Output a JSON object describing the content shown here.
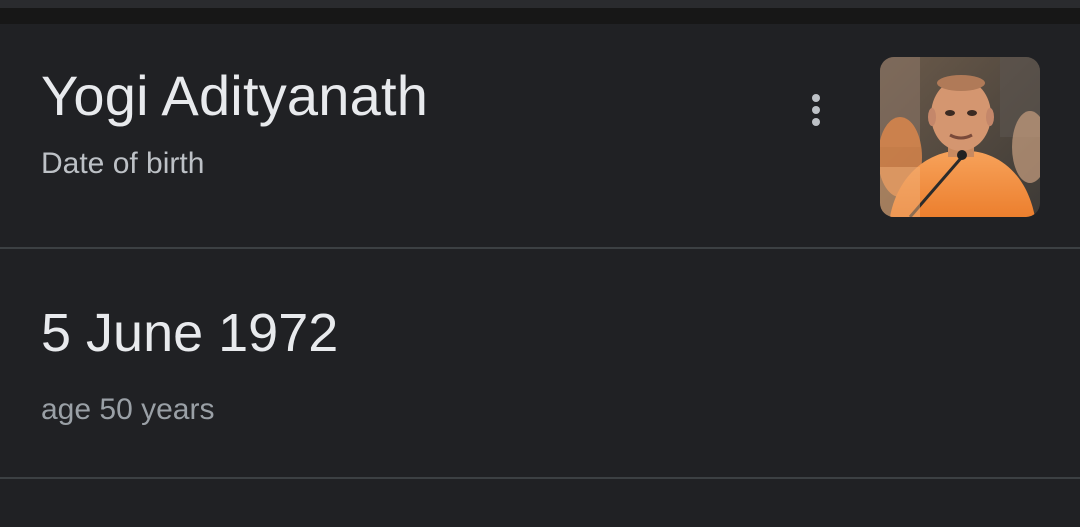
{
  "entity": {
    "name": "Yogi Adityanath",
    "attribute_label": "Date of birth",
    "thumbnail_icon": "person-photo"
  },
  "answer": {
    "value": "5 June 1972",
    "detail": "age 50 years"
  },
  "menu": {
    "icon": "more-vert-icon"
  },
  "colors": {
    "background": "#202124",
    "divider": "#3c4043",
    "primary_text": "#e8eaed",
    "secondary_text": "#bdc1c6",
    "muted_text": "#9aa0a6",
    "photo_accent": "#f08a3c"
  }
}
